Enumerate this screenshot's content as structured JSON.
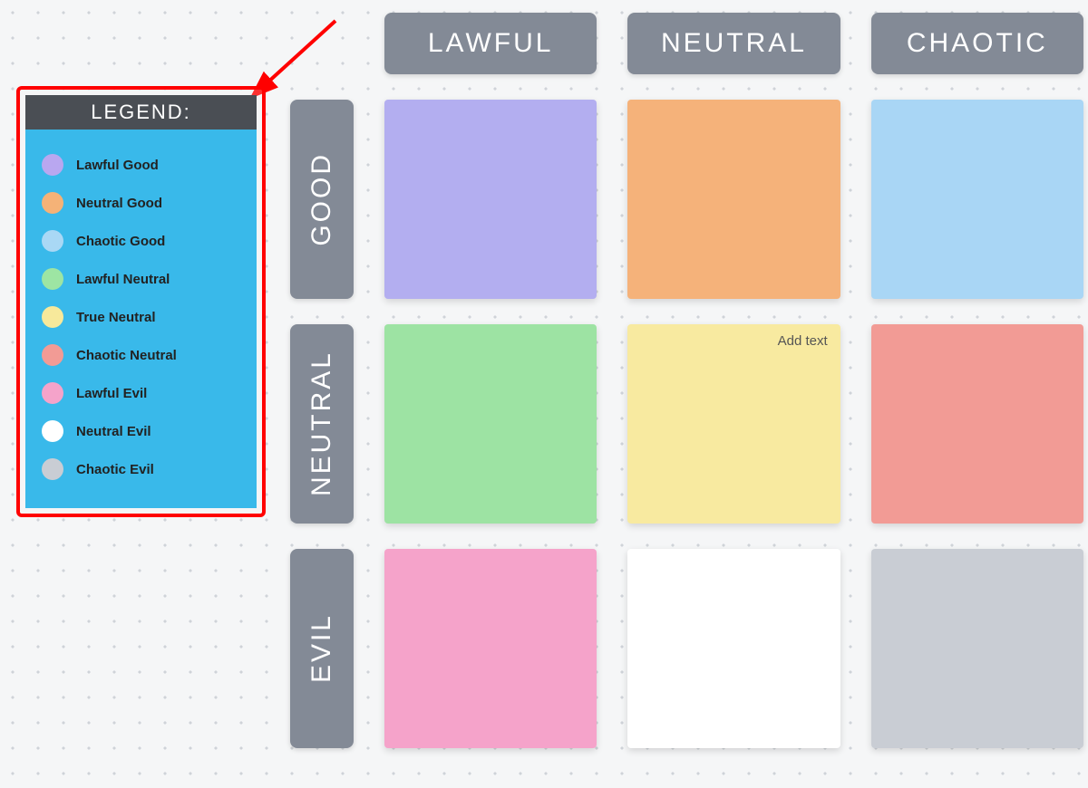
{
  "legend": {
    "title": "LEGEND:",
    "items": [
      {
        "label": "Lawful Good",
        "color": "#b9a7f0"
      },
      {
        "label": "Neutral Good",
        "color": "#f5b277"
      },
      {
        "label": "Chaotic Good",
        "color": "#a9d8f5"
      },
      {
        "label": "Lawful Neutral",
        "color": "#9de5a3"
      },
      {
        "label": "True Neutral",
        "color": "#f7e99b"
      },
      {
        "label": "Chaotic Neutral",
        "color": "#f29b95"
      },
      {
        "label": "Lawful Evil",
        "color": "#f5a3ca"
      },
      {
        "label": "Neutral Evil",
        "color": "#ffffff"
      },
      {
        "label": "Chaotic Evil",
        "color": "#c9cdd4"
      }
    ]
  },
  "grid": {
    "columns": [
      "LAWFUL",
      "NEUTRAL",
      "CHAOTIC"
    ],
    "rows": [
      "GOOD",
      "NEUTRAL",
      "EVIL"
    ],
    "cells": [
      [
        {
          "color": "#b3aef0"
        },
        {
          "color": "#f5b27a"
        },
        {
          "color": "#a9d6f5"
        }
      ],
      [
        {
          "color": "#9de3a3"
        },
        {
          "color": "#f8eaa0",
          "placeholder": "Add text"
        },
        {
          "color": "#f29b95"
        }
      ],
      [
        {
          "color": "#f5a3ca"
        },
        {
          "color": "#ffffff"
        },
        {
          "color": "#c9cdd4"
        }
      ]
    ]
  },
  "annotation": {
    "arrow_color": "#ff0000",
    "highlight_color": "#ff0000"
  }
}
